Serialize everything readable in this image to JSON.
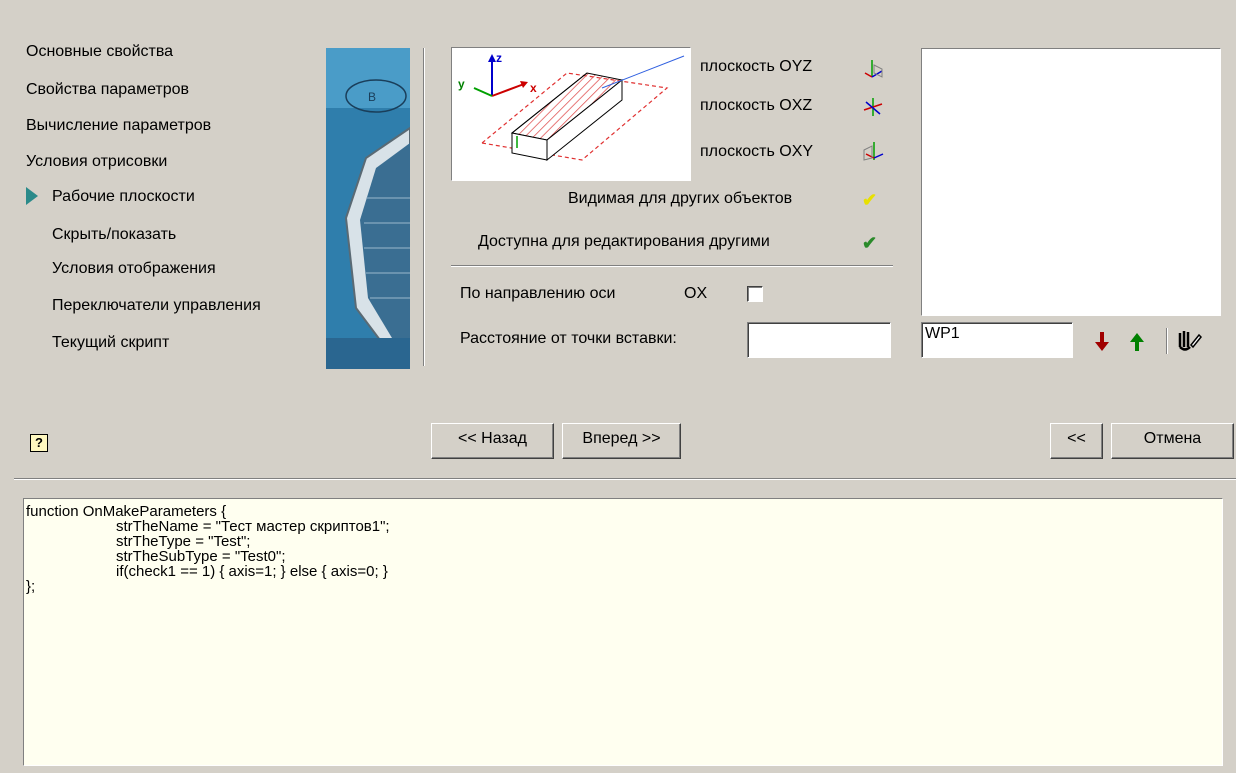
{
  "nav": {
    "items": [
      {
        "label": "Основные свойства",
        "active": false
      },
      {
        "label": "Свойства параметров",
        "active": false
      },
      {
        "label": "Вычисление параметров",
        "active": false
      },
      {
        "label": "Условия отрисовки",
        "active": false
      },
      {
        "label": "Рабочие плоскости",
        "active": true
      },
      {
        "label": "Скрыть/показать",
        "active": false
      },
      {
        "label": "Условия отображения",
        "active": false
      },
      {
        "label": "Переключатели управления",
        "active": false
      },
      {
        "label": "Текущий скрипт",
        "active": false
      }
    ]
  },
  "planes": {
    "oyz": "плоскость OYZ",
    "oxz": "плоскость OXZ",
    "oxy": "плоскость OXY",
    "visible_label": "Видимая для других объектов",
    "editable_label": "Доступна для редактирования другими",
    "preview_axes": {
      "x": "x",
      "y": "y",
      "z": "z"
    }
  },
  "direction": {
    "label": "По направлению оси",
    "axis": "OX",
    "checked": false
  },
  "distance": {
    "label": "Расстояние от точки вставки:",
    "value": ""
  },
  "workplane": {
    "name_value": "WP1",
    "icons": [
      "arrow-down-icon",
      "arrow-up-icon",
      "hand-edit-icon"
    ]
  },
  "buttons": {
    "back": "<< Назад",
    "next": "Вперед >>",
    "collapse": "<<",
    "cancel": "Отмена",
    "help": "?"
  },
  "script": {
    "lines": [
      "function OnMakeParameters {",
      "strTheName = \"Тест мастер скриптов1\";",
      "strTheType = \"Test\";",
      "strTheSubType = \"Test0\";",
      "if(check1 == 1) { axis=1; } else { axis=0; }",
      "};"
    ]
  },
  "colors": {
    "background": "#d4d0c8",
    "nav_arrow": "#2a8a8a",
    "script_bg": "#fffff0",
    "preview_hatch": "#e05050",
    "preview_axis_x": "#cc0000",
    "preview_axis_y": "#00a000",
    "preview_axis_z": "#0000cc"
  }
}
